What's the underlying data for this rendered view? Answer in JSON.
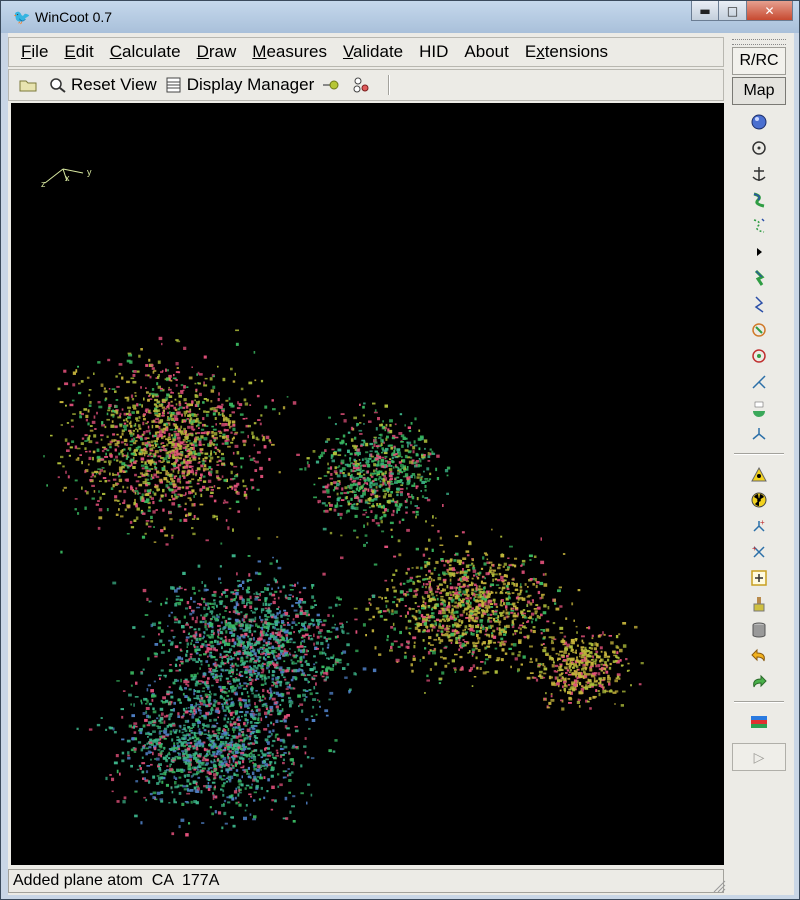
{
  "window": {
    "title": "WinCoot 0.7",
    "min_symbol": "▬",
    "max_symbol": "□",
    "close_symbol": "✕"
  },
  "menubar": {
    "items": [
      {
        "mnemonic": "F",
        "rest": "ile"
      },
      {
        "mnemonic": "E",
        "rest": "dit"
      },
      {
        "mnemonic": "C",
        "rest": "alculate"
      },
      {
        "mnemonic": "D",
        "rest": "raw"
      },
      {
        "mnemonic": "M",
        "rest": "easures"
      },
      {
        "mnemonic": "V",
        "rest": "alidate"
      },
      {
        "mnemonic": "",
        "rest": "HID"
      },
      {
        "mnemonic": "",
        "rest": "About"
      },
      {
        "mnemonic": "x",
        "prefix": "E",
        "rest": "tensions"
      }
    ]
  },
  "toolbar": {
    "reset_view_label": "Reset View",
    "display_manager_label": "Display Manager"
  },
  "axes_labels": {
    "x": "x",
    "y": "y",
    "z": "z"
  },
  "sidebar": {
    "rrc_label": "R/RC",
    "map_label": "Map",
    "play_symbol": "▷",
    "icons": [
      "rotate-translate-zone-icon",
      "refine-regularize-icon",
      "rigid-body-fit-icon",
      "real-space-refine-icon",
      "regularize-zone-icon",
      "expand-arrow-icon",
      "pepflip-icon",
      "sidechain-icon",
      "rotamer-icon",
      "torsion-icon",
      "backbone-torsion-icon",
      "side-chain-180-icon",
      "edit-chi-icon",
      "add-atom-icon",
      "delete-icon",
      "add-terminal-residue-icon",
      "mutate-icon",
      "place-atom-icon",
      "clear-pending-icon",
      "bin-icon",
      "undo-icon",
      "redo-icon",
      "flag-icon"
    ]
  },
  "status": {
    "text": "Added plane atom  CA  177A"
  },
  "colors": {
    "pink": "#e0507a",
    "green": "#39b760",
    "yellowgreen": "#aebd3a",
    "teal": "#3cb48a",
    "blue": "#4f7fc4",
    "olive": "#c6b43c"
  }
}
